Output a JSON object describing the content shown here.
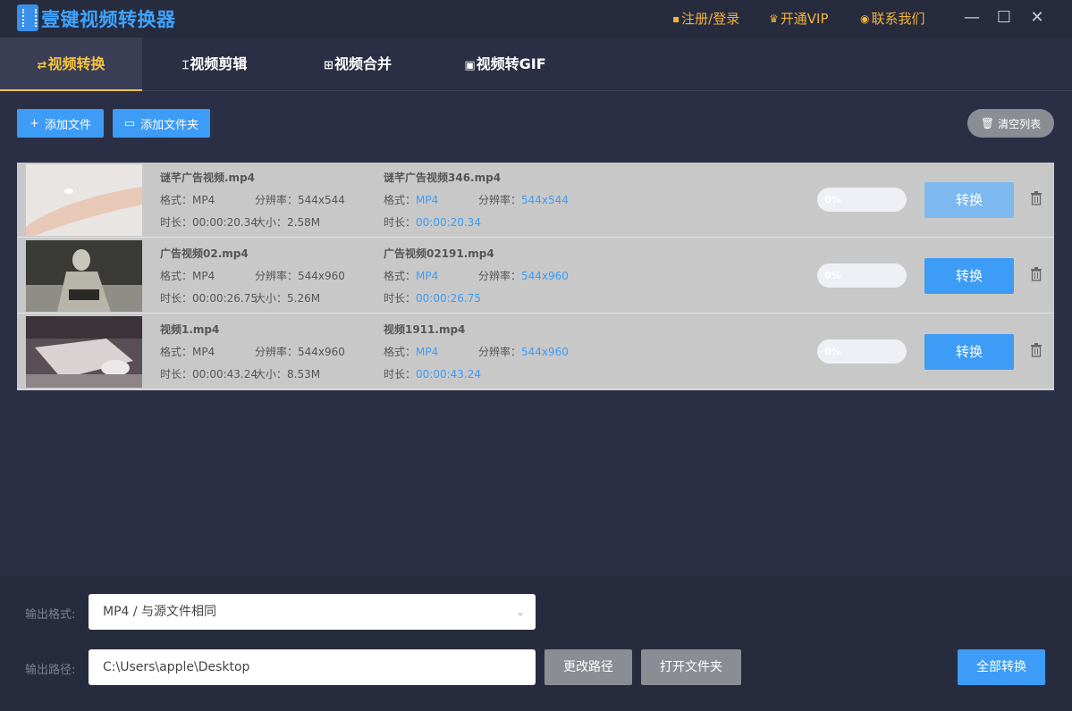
{
  "app": {
    "title": "壹键视频转换器"
  },
  "header": {
    "register_login": "注册/登录",
    "open_vip": "开通VIP",
    "contact_us": "联系我们"
  },
  "tabs": [
    {
      "label": "视频转换",
      "icon": "convert-icon",
      "active": true
    },
    {
      "label": "视频剪辑",
      "icon": "cut-icon",
      "active": false
    },
    {
      "label": "视频合并",
      "icon": "merge-icon",
      "active": false
    },
    {
      "label": "视频转GIF",
      "icon": "gif-icon",
      "active": false
    }
  ],
  "toolbar": {
    "add_file": "添加文件",
    "add_folder": "添加文件夹",
    "clear_list": "清空列表"
  },
  "labels": {
    "format": "格式：",
    "resolution": "分辨率：",
    "duration": "时长：",
    "size": "大小：",
    "convert": "转换"
  },
  "files": [
    {
      "src_name": "谜芊广告视频.mp4",
      "src_format": "MP4",
      "src_resolution": "544x544",
      "src_duration": "00:00:20.34",
      "src_size": "2.58M",
      "out_name": "谜芊广告视频346.mp4",
      "out_format": "MP4",
      "out_resolution": "544x544",
      "out_duration": "00:00:20.34",
      "progress_text": "0%",
      "progress": 0
    },
    {
      "src_name": "广告视频02.mp4",
      "src_format": "MP4",
      "src_resolution": "544x960",
      "src_duration": "00:00:26.75",
      "src_size": "5.26M",
      "out_name": "广告视频02191.mp4",
      "out_format": "MP4",
      "out_resolution": "544x960",
      "out_duration": "00:00:26.75",
      "progress_text": "0%",
      "progress": 0
    },
    {
      "src_name": "视频1.mp4",
      "src_format": "MP4",
      "src_resolution": "544x960",
      "src_duration": "00:00:43.24",
      "src_size": "8.53M",
      "out_name": "视频1911.mp4",
      "out_format": "MP4",
      "out_resolution": "544x960",
      "out_duration": "00:00:43.24",
      "progress_text": "0%",
      "progress": 0
    }
  ],
  "output": {
    "format_label": "输出格式:",
    "format_value": "MP4 / 与源文件相同",
    "path_label": "输出路径:",
    "path_value": "C:\\Users\\apple\\Desktop",
    "change_path": "更改路径",
    "open_folder": "打开文件夹",
    "convert_all": "全部转换"
  },
  "colors": {
    "accent_blue": "#3d9cf5",
    "active_tab": "#f5c242",
    "header_link": "#f0b23c"
  }
}
